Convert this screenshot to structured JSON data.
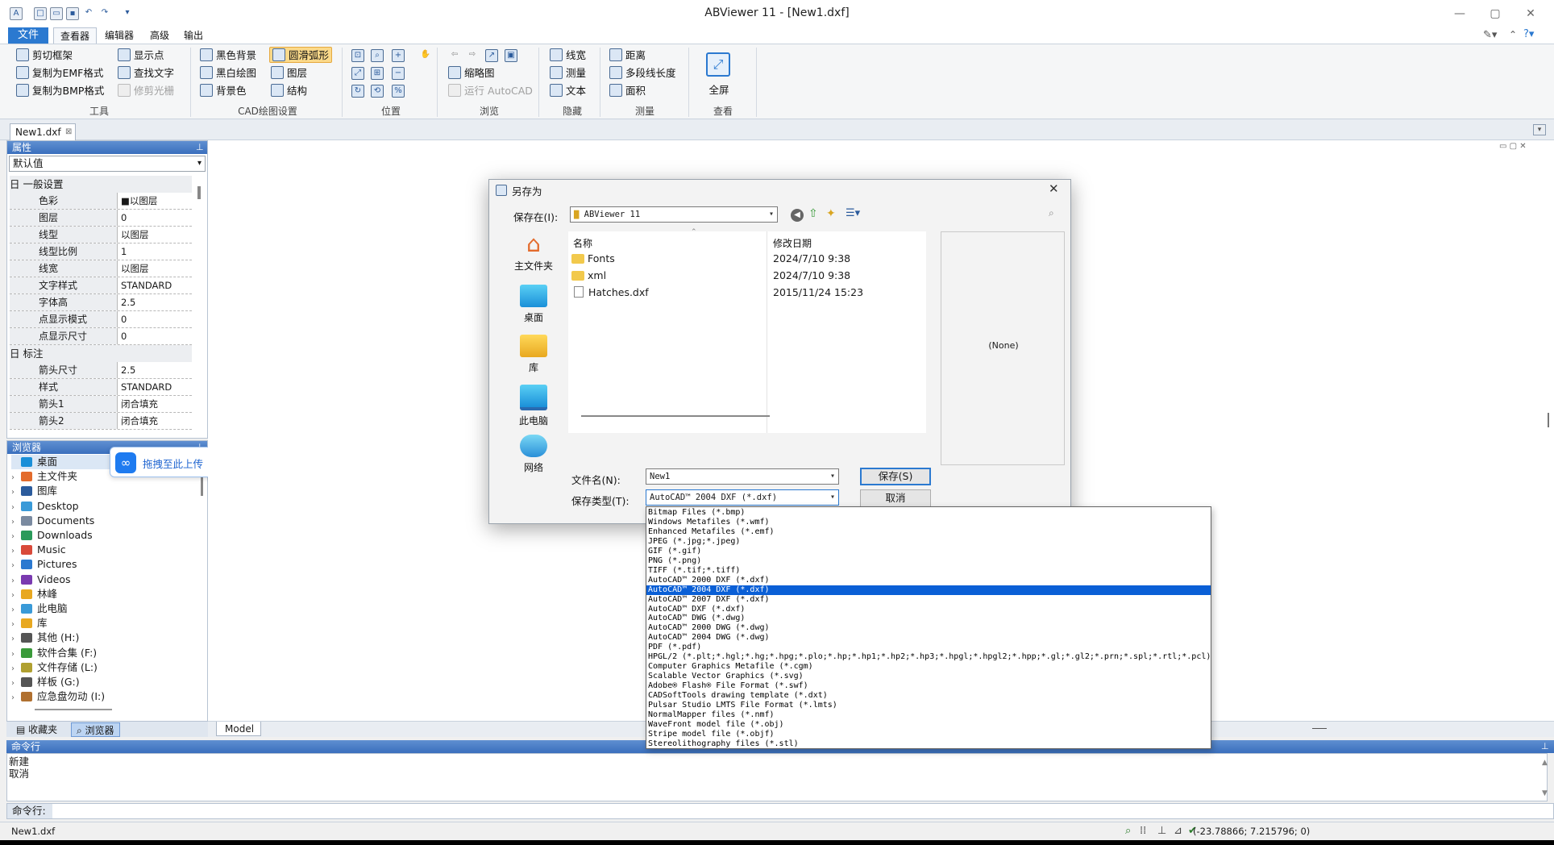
{
  "window": {
    "title": "ABViewer 11 - [New1.dxf]"
  },
  "menu": {
    "file": "文件",
    "tabs": [
      "查看器",
      "编辑器",
      "高级",
      "输出"
    ]
  },
  "ribbon": {
    "tools": {
      "label": "工具",
      "items": [
        "剪切框架",
        "复制为EMF格式",
        "复制为BMP格式",
        "显示点",
        "查找文字",
        "修剪光栅"
      ]
    },
    "cad": {
      "label": "CAD绘图设置",
      "items": [
        "黑色背景",
        "黑白绘图",
        "背景色",
        "圆滑弧形",
        "图层",
        "结构"
      ]
    },
    "position": {
      "label": "位置"
    },
    "browse": {
      "label": "浏览",
      "items": [
        "缩略图",
        "运行 AutoCAD"
      ]
    },
    "hide": {
      "label": "隐藏",
      "items": [
        "线宽",
        "测量",
        "文本"
      ]
    },
    "measure": {
      "label": "测量",
      "items": [
        "距离",
        "多段线长度",
        "面积"
      ]
    },
    "view": {
      "label": "查看",
      "items": [
        "全屏"
      ]
    }
  },
  "doc_tab": "New1.dxf",
  "properties": {
    "title": "属性",
    "selector": "默认值",
    "cat_general": "日 一般设置",
    "general": [
      {
        "k": "色彩",
        "v": "■以图层"
      },
      {
        "k": "图层",
        "v": "0"
      },
      {
        "k": "线型",
        "v": "以图层"
      },
      {
        "k": "线型比例",
        "v": "1"
      },
      {
        "k": "线宽",
        "v": "以图层"
      },
      {
        "k": "文字样式",
        "v": "STANDARD"
      },
      {
        "k": "字体高",
        "v": "2.5"
      },
      {
        "k": "点显示模式",
        "v": "0"
      },
      {
        "k": "点显示尺寸",
        "v": "0"
      }
    ],
    "cat_dim": "日 标注",
    "dim": [
      {
        "k": "箭头尺寸",
        "v": "2.5"
      },
      {
        "k": "样式",
        "v": "STANDARD"
      },
      {
        "k": "箭头1",
        "v": "闭合填充"
      },
      {
        "k": "箭头2",
        "v": "闭合填充"
      }
    ]
  },
  "browser": {
    "title": "浏览器",
    "upload_hint": "拖拽至此上传",
    "items": [
      "桌面",
      "主文件夹",
      "图库",
      "Desktop",
      "Documents",
      "Downloads",
      "Music",
      "Pictures",
      "Videos",
      "林峰",
      "此电脑",
      "库",
      "其他 (H:)",
      "软件合集 (F:)",
      "文件存储 (L:)",
      "样板 (G:)",
      "应急盘勿动 (I:)"
    ],
    "bottom_tabs": [
      "收藏夹",
      "浏览器"
    ]
  },
  "model_tab": "Model",
  "dialog": {
    "title": "另存为",
    "save_in_label": "保存在(I):",
    "save_in_value": "ABViewer 11",
    "places": [
      "主文件夹",
      "桌面",
      "库",
      "此电脑",
      "网络"
    ],
    "col_name": "名称",
    "col_date": "修改日期",
    "files": [
      {
        "name": "Fonts",
        "date": "2024/7/10 9:38",
        "type": "folder"
      },
      {
        "name": "xml",
        "date": "2024/7/10 9:38",
        "type": "folder"
      },
      {
        "name": "Hatches.dxf",
        "date": "2015/11/24 15:23",
        "type": "file"
      }
    ],
    "preview": "(None)",
    "filename_label": "文件名(N):",
    "filename_value": "New1",
    "filetype_label": "保存类型(T):",
    "filetype_value": "AutoCAD™ 2004 DXF (*.dxf)",
    "save_button": "保存(S)",
    "cancel_button": "取消"
  },
  "filetype_options": [
    "Bitmap Files (*.bmp)",
    "Windows Metafiles (*.wmf)",
    "Enhanced Metafiles (*.emf)",
    "JPEG (*.jpg;*.jpeg)",
    "GIF (*.gif)",
    "PNG (*.png)",
    "TIFF (*.tif;*.tiff)",
    "AutoCAD™ 2000 DXF (*.dxf)",
    "AutoCAD™ 2004 DXF (*.dxf)",
    "AutoCAD™ 2007 DXF (*.dxf)",
    "AutoCAD™ DXF (*.dxf)",
    "AutoCAD™ DWG (*.dwg)",
    "AutoCAD™ 2000 DWG (*.dwg)",
    "AutoCAD™ 2004 DWG (*.dwg)",
    "PDF (*.pdf)",
    "HPGL/2 (*.plt;*.hgl;*.hg;*.hpg;*.plo;*.hp;*.hp1;*.hp2;*.hp3;*.hpgl;*.hpgl2;*.hpp;*.gl;*.gl2;*.prn;*.spl;*.rtl;*.pcl)",
    "Computer Graphics Metafile (*.cgm)",
    "Scalable Vector Graphics (*.svg)",
    "Adobe® Flash® File Format (*.swf)",
    "CADSoftTools drawing template (*.dxt)",
    "Pulsar Studio LMTS File Format (*.lmts)",
    "NormalMapper files (*.nmf)",
    "WaveFront model file (*.obj)",
    "Stripe model file (*.objf)",
    "Stereolithography files (*.stl)"
  ],
  "selected_filetype_index": 8,
  "command": {
    "title": "命令行",
    "history": [
      "新建",
      "取消"
    ],
    "prompt": "命令行:"
  },
  "status": {
    "file": "New1.dxf",
    "coords": "(-23.78866; 7.215796; 0)"
  },
  "colors": {
    "accent": "#2b79d0",
    "panel_head": "#3a6fbd",
    "dropdown_selected": "#0a5fd6"
  }
}
